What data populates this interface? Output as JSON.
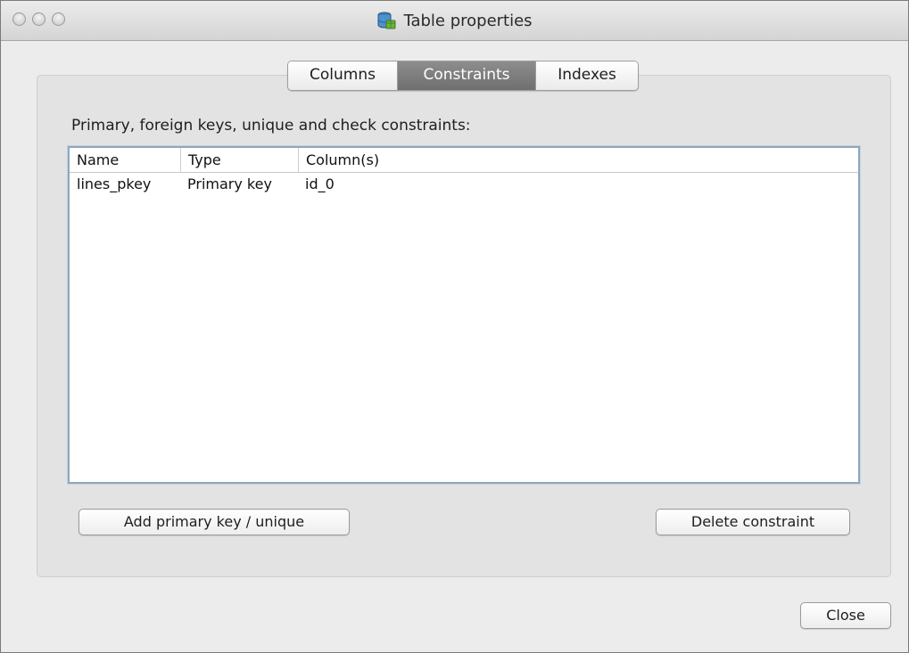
{
  "window": {
    "title": "Table properties",
    "title_icon": "database-table-icon"
  },
  "tabs": [
    {
      "label": "Columns",
      "active": false
    },
    {
      "label": "Constraints",
      "active": true
    },
    {
      "label": "Indexes",
      "active": false
    }
  ],
  "constraints": {
    "section_label": "Primary, foreign keys, unique and check constraints:",
    "columns": [
      "Name",
      "Type",
      "Column(s)"
    ],
    "rows": [
      [
        "lines_pkey",
        "Primary key",
        "id_0"
      ]
    ]
  },
  "buttons": {
    "add_primary_key": "Add primary key / unique",
    "delete_constraint": "Delete constraint",
    "close": "Close"
  },
  "colors": {
    "active_tab": "#7a7a7a",
    "table_focus_border": "#8fa6bf"
  }
}
